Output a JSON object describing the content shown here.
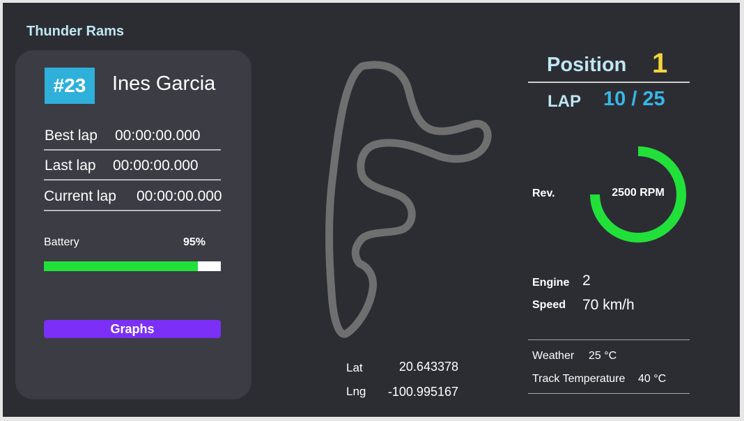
{
  "team": {
    "name": "Thunder Rams"
  },
  "driver": {
    "number": "#23",
    "name": "Ines Garcia",
    "laps": [
      {
        "label": "Best lap",
        "value": "00:00:00.000"
      },
      {
        "label": "Last lap",
        "value": "00:00:00.000"
      },
      {
        "label": "Current lap",
        "value": "00:00:00.000"
      }
    ],
    "battery": {
      "label": "Battery",
      "value": "95%",
      "percent": 87
    },
    "graphs_button": "Graphs"
  },
  "track": {
    "icon": "track-map",
    "coordinates": [
      {
        "label": "Lat",
        "value": "20.643378"
      },
      {
        "label": "Lng",
        "value": "-100.995167"
      }
    ]
  },
  "race": {
    "position_label": "Position",
    "position_value": "1",
    "lap_label": "LAP",
    "lap_value": "10 / 25"
  },
  "engine": {
    "rev_label": "Rev.",
    "rpm_text": "2500 RPM",
    "rpm_fraction": 0.75,
    "engine_label": "Engine",
    "engine_value": "2",
    "speed_label": "Speed",
    "speed_value": "70 km/h"
  },
  "environment": {
    "weather_label": "Weather",
    "weather_value": "25 °C",
    "track_temp_label": "Track Temperature",
    "track_temp_value": "40 °C"
  },
  "colors": {
    "background": "#2c2d33",
    "card": "#3b3c44",
    "number_badge": "#2fb0da",
    "battery_fill": "#22e03a",
    "graphs_button": "#7b2ff7",
    "position_value": "#f5d33a",
    "lap_value": "#37b7e8",
    "rpm_arc": "#22e03a",
    "track_line": "#6f6f6f"
  }
}
